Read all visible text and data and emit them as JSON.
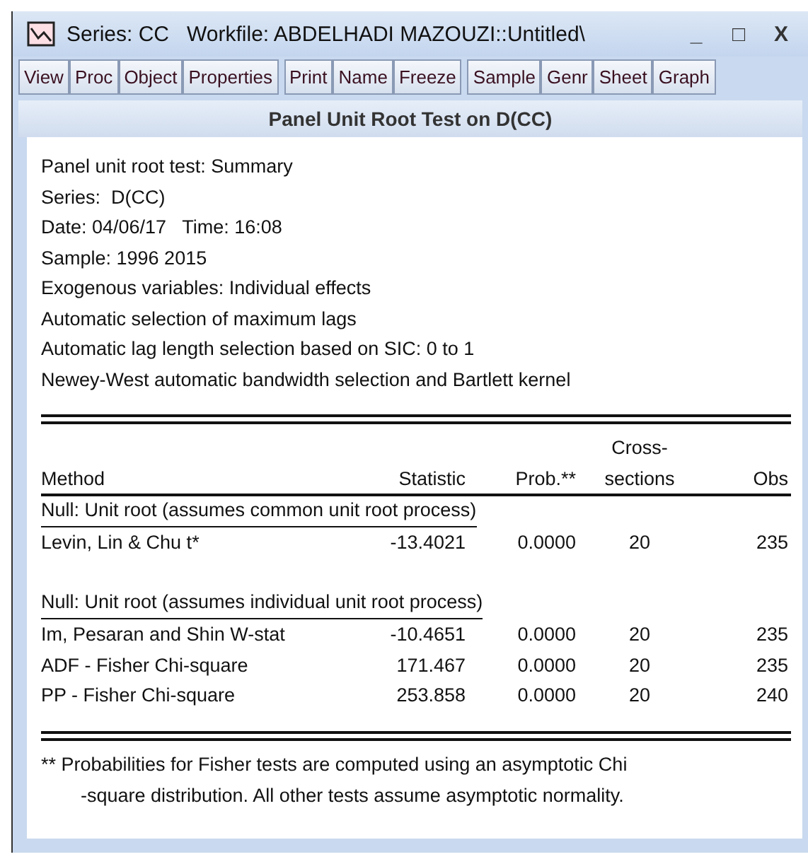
{
  "window": {
    "title": "Series: CC   Workfile: ABDELHADI MAZOUZI::Untitled\\",
    "controls": [
      "_",
      "□",
      "X"
    ]
  },
  "toolbar": [
    [
      "View",
      "Proc",
      "Object",
      "Properties"
    ],
    [
      "Print",
      "Name",
      "Freeze"
    ],
    [
      "Sample",
      "Genr",
      "Sheet",
      "Graph"
    ]
  ],
  "view_title": "Panel Unit Root Test on D(CC)",
  "summary_lines": [
    "Panel unit root test: Summary",
    "Series:  D(CC)",
    "Date: 04/06/17   Time: 16:08",
    "Sample: 1996 2015",
    "Exogenous variables: Individual effects",
    "Automatic selection of maximum lags",
    "Automatic lag length selection based on SIC: 0 to 1",
    "Newey-West automatic bandwidth selection and Bartlett kernel"
  ],
  "table": {
    "columns": [
      [
        "Method"
      ],
      [
        "Statistic"
      ],
      [
        "Prob.**"
      ],
      [
        "Cross-",
        "sections"
      ],
      [
        "Obs"
      ]
    ],
    "rows": [
      {
        "kind": "heading",
        "text": "Null: Unit root (assumes common unit root process)"
      },
      {
        "kind": "data",
        "cells": [
          "Levin, Lin & Chu t*",
          "-13.4021",
          "0.0000",
          "20",
          "235"
        ]
      },
      {
        "kind": "blank"
      },
      {
        "kind": "heading",
        "text": "Null: Unit root (assumes individual unit root process)"
      },
      {
        "kind": "data",
        "cells": [
          "Im, Pesaran and Shin W-stat",
          "-10.4651",
          "0.0000",
          "20",
          "235"
        ]
      },
      {
        "kind": "data",
        "cells": [
          "ADF - Fisher Chi-square",
          "171.467",
          "0.0000",
          "20",
          "235"
        ]
      },
      {
        "kind": "data",
        "cells": [
          "PP - Fisher Chi-square",
          "253.858",
          "0.0000",
          "20",
          "240"
        ]
      }
    ]
  },
  "footnote": [
    "** Probabilities for Fisher tests are computed using an asymptotic Chi",
    "-square distribution. All other tests assume asymptotic normality."
  ]
}
